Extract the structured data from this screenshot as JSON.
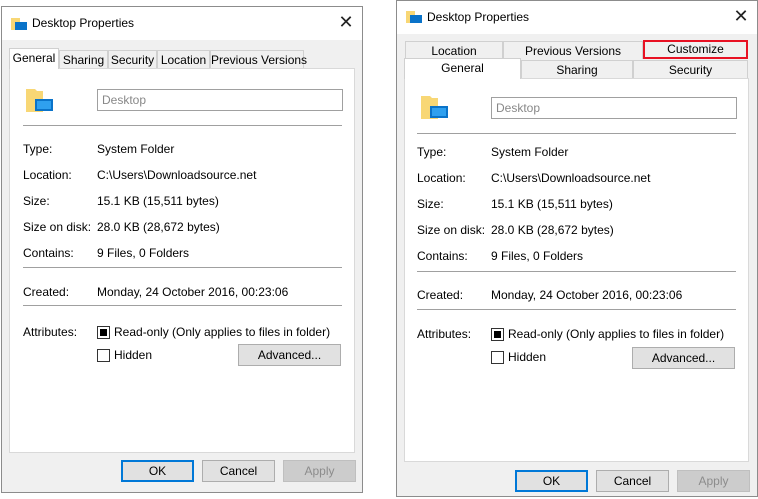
{
  "left_dialog": {
    "title": "Desktop Properties",
    "close": "✕",
    "tabs": [
      "General",
      "Sharing",
      "Security",
      "Location",
      "Previous Versions"
    ],
    "active_tab": "General",
    "name_field_value": "Desktop",
    "properties": [
      {
        "label": "Type:",
        "value": "System Folder"
      },
      {
        "label": "Location:",
        "value": "C:\\Users\\Downloadsource.net"
      },
      {
        "label": "Size:",
        "value": "15.1 KB (15,511 bytes)"
      },
      {
        "label": "Size on disk:",
        "value": "28.0 KB (28,672 bytes)"
      },
      {
        "label": "Contains:",
        "value": "9 Files, 0 Folders"
      }
    ],
    "created_label": "Created:",
    "created_value": "Monday, 24 October 2016, 00:23:06",
    "attributes_label": "Attributes:",
    "readonly_label": "Read-only (Only applies to files in folder)",
    "readonly_checked": true,
    "hidden_label": "Hidden",
    "hidden_checked": false,
    "advanced_button": "Advanced...",
    "ok_button": "OK",
    "cancel_button": "Cancel",
    "apply_button": "Apply"
  },
  "right_dialog": {
    "title": "Desktop Properties",
    "close": "✕",
    "tabs_back_row": [
      "Location",
      "Previous Versions",
      "Customize"
    ],
    "tabs_front_row": [
      "General",
      "Sharing",
      "Security"
    ],
    "active_tab": "General",
    "highlighted_tab": "Customize",
    "highlight_color": "#e81123",
    "name_field_value": "Desktop",
    "properties": [
      {
        "label": "Type:",
        "value": "System Folder"
      },
      {
        "label": "Location:",
        "value": "C:\\Users\\Downloadsource.net"
      },
      {
        "label": "Size:",
        "value": "15.1 KB (15,511 bytes)"
      },
      {
        "label": "Size on disk:",
        "value": "28.0 KB (28,672 bytes)"
      },
      {
        "label": "Contains:",
        "value": "9 Files, 0 Folders"
      }
    ],
    "created_label": "Created:",
    "created_value": "Monday, 24 October 2016, 00:23:06",
    "attributes_label": "Attributes:",
    "readonly_label": "Read-only (Only applies to files in folder)",
    "readonly_checked": true,
    "hidden_label": "Hidden",
    "hidden_checked": false,
    "advanced_button": "Advanced...",
    "ok_button": "OK",
    "cancel_button": "Cancel",
    "apply_button": "Apply"
  },
  "colors": {
    "dialog_bg": "#f0f0f0",
    "panel_bg": "#ffffff",
    "default_button_border": "#0078d7",
    "folder_yellow": "#f8d775",
    "folder_blue": "#0a73c9"
  },
  "icons": [
    "folder-desktop-icon",
    "close-icon"
  ]
}
